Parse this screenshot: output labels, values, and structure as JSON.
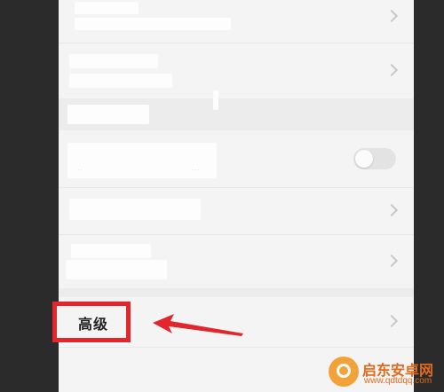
{
  "settings": {
    "advanced_label": "高级"
  },
  "watermark": {
    "title": "启东安卓网",
    "url": "www.qdtdqq.com"
  },
  "icons": [
    "chevron-right-icon",
    "arrow-icon",
    "toggle-switch"
  ],
  "colors": {
    "highlight": "#e2262b",
    "panel_bg": "#f4f4f4",
    "side_bg": "#2b2b2b",
    "watermark": "#e06a1c"
  }
}
